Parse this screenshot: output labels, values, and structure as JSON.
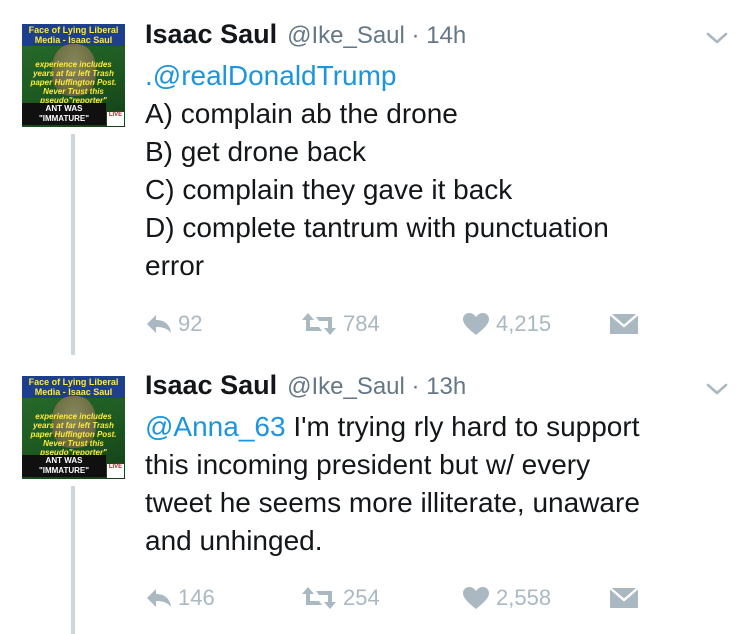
{
  "tweets": [
    {
      "author_name": "Isaac Saul",
      "handle": "@Ike_Saul",
      "time": "14h",
      "avatar": {
        "header": "Face of Lying Liberal Media - Isaac Saul",
        "body": "experience includes years at far left Trash paper Huffington Post. Never Trust this pseudo\"reporter\"",
        "footer": "ANT WAS \"IMMATURE\"",
        "badge": "LIVE"
      },
      "mention": ".@realDonaldTrump",
      "lines": [
        "A) complain ab the drone",
        "B) get drone back",
        "C) complain they gave it back",
        "D) complete tantrum with punctuation",
        "error"
      ],
      "replies": "92",
      "retweets": "784",
      "likes": "4,215"
    },
    {
      "author_name": "Isaac Saul",
      "handle": "@Ike_Saul",
      "time": "13h",
      "avatar": {
        "header": "Face of Lying Liberal Media - Isaac Saul",
        "body": "experience includes years at far left Trash paper Huffington Post. Never Trust this pseudo\"reporter\"",
        "footer": "ANT WAS \"IMMATURE\"",
        "badge": "LIVE"
      },
      "mention": "@Anna_63",
      "first_line_rest": " I'm trying rly hard to support",
      "lines": [
        "this incoming president but w/ every",
        "tweet he seems more illiterate, unaware",
        "and unhinged."
      ],
      "replies": "146",
      "retweets": "254",
      "likes": "2,558"
    }
  ],
  "colors": {
    "mention": "#1b95e0",
    "meta_gray": "#657786",
    "action_gray": "#aab8c2",
    "thread_line": "#ccd6dd"
  },
  "icons": [
    "reply-icon",
    "retweet-icon",
    "like-icon",
    "direct-message-icon",
    "chevron-down-icon"
  ]
}
